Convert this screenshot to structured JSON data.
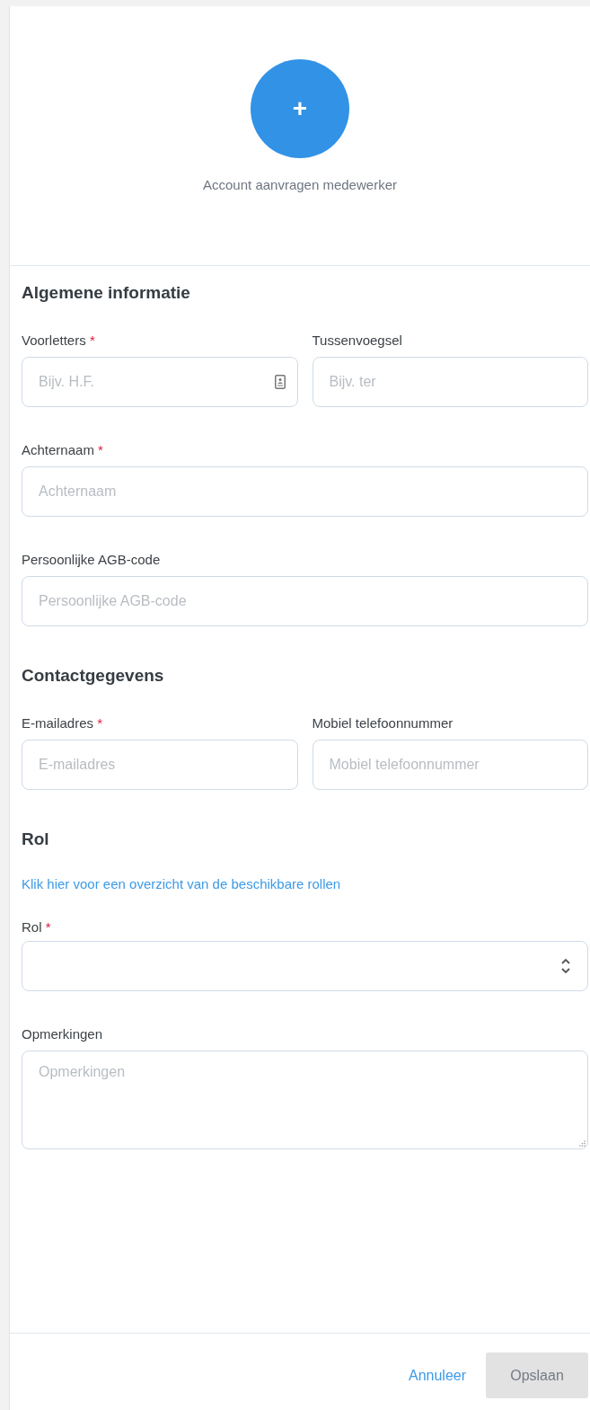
{
  "header": {
    "action_label": "+",
    "title": "Account aanvragen medewerker"
  },
  "sections": [
    {
      "title": "Algemene informatie",
      "rows": [
        {
          "fields": [
            {
              "kind": "text",
              "label": "Voorletters",
              "required_mark": "*",
              "placeholder": "Bijv. H.F.",
              "autofill": true
            },
            {
              "kind": "text",
              "label": "Tussenvoegsel",
              "placeholder": "Bijv. ter",
              "autofill": false
            }
          ]
        },
        {
          "fields": [
            {
              "kind": "text",
              "label": "Achternaam",
              "required_mark": "*",
              "placeholder": "Achternaam",
              "autofill": false
            }
          ]
        },
        {
          "fields": [
            {
              "kind": "text",
              "label": "Persoonlijke AGB-code",
              "placeholder": "Persoonlijke AGB-code",
              "autofill": false
            }
          ]
        }
      ]
    },
    {
      "title": "Contactgegevens",
      "rows": [
        {
          "fields": [
            {
              "kind": "text",
              "label": "E-mailadres",
              "required_mark": "*",
              "placeholder": "E-mailadres",
              "autofill": false
            },
            {
              "kind": "text",
              "label": "Mobiel telefoonnummer",
              "placeholder": "Mobiel telefoonnummer",
              "autofill": false
            }
          ]
        }
      ]
    },
    {
      "title": "Rol",
      "link": "Klik hier voor een overzicht van de beschikbare rollen",
      "rows": [
        {
          "fields": [
            {
              "kind": "select",
              "label": "Rol",
              "required_mark": "*"
            }
          ]
        },
        {
          "fields": [
            {
              "kind": "textarea",
              "label": "Opmerkingen",
              "placeholder": "Opmerkingen"
            }
          ]
        }
      ]
    }
  ],
  "footer": {
    "cancel": "Annuleer",
    "save": {
      "label": "Opslaan",
      "disabled": true
    }
  }
}
